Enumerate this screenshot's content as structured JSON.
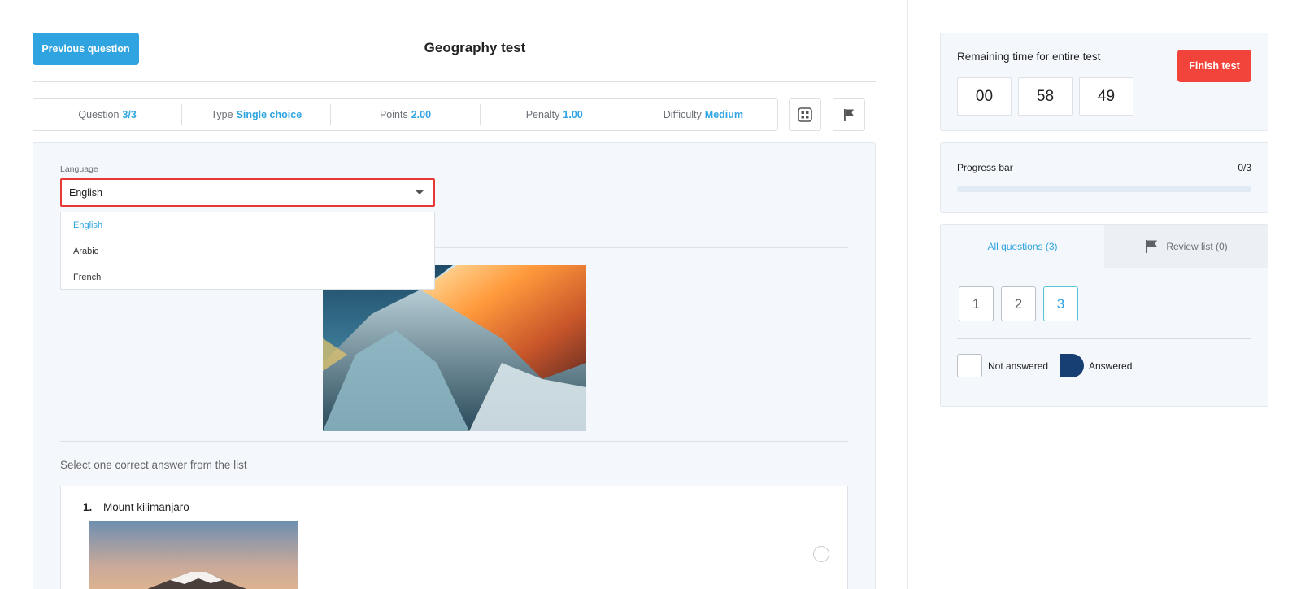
{
  "header": {
    "prev_label": "Previous question",
    "title": "Geography test"
  },
  "meta": {
    "question_label": "Question",
    "question_value": "3/3",
    "type_label": "Type",
    "type_value": "Single choice",
    "points_label": "Points",
    "points_value": "2.00",
    "penalty_label": "Penalty",
    "penalty_value": "1.00",
    "difficulty_label": "Difficulty",
    "difficulty_value": "Medium"
  },
  "language": {
    "label": "Language",
    "selected": "English",
    "options": [
      "English",
      "Arabic",
      "French"
    ]
  },
  "question": {
    "instruction": "Select one correct answer from the list",
    "answers": [
      {
        "num": "1.",
        "text": "Mount kilimanjaro"
      }
    ]
  },
  "timer": {
    "label": "Remaining time for entire test",
    "finish_label": "Finish test",
    "hours": "00",
    "minutes": "58",
    "seconds": "49"
  },
  "progress": {
    "label": "Progress bar",
    "count": "0/3",
    "fraction": 0
  },
  "nav": {
    "all_tab": "All questions (3)",
    "review_tab": "Review list (0)",
    "questions": [
      "1",
      "2",
      "3"
    ],
    "current": "3",
    "legend_not_answered": "Not answered",
    "legend_answered": "Answered"
  },
  "colors": {
    "accent": "#2fa4e0",
    "danger": "#f2443a",
    "answered": "#173f73",
    "panel_bg": "#f4f7fc"
  }
}
